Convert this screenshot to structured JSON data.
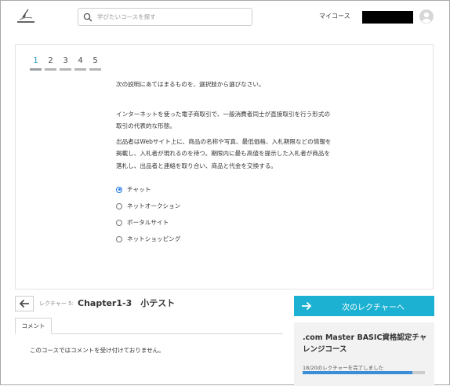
{
  "header": {
    "search_placeholder": "学びたいコースを探す",
    "my_course_label": "マイコース"
  },
  "quiz": {
    "tabs": [
      {
        "label": "1",
        "active": true
      },
      {
        "label": "2",
        "active": false
      },
      {
        "label": "3",
        "active": false
      },
      {
        "label": "4",
        "active": false
      },
      {
        "label": "5",
        "active": false
      }
    ],
    "instruction": "次の説明にあてはまるものを、選択肢から選びなさい。",
    "paragraph1": "インターネットを使った電子商取引で、一般消費者同士が直接取引を行う形式の取引の代表的な形態。",
    "paragraph2": "出品者はWebサイト上に、商品の名称や写真、最低価格、入札期限などの情報を掲載し、入札者が現れるのを待つ。期限内に最も高値を提示した入札者が商品を落札し、出品者と連絡を取り合い、商品と代金を交換する。",
    "options": [
      {
        "label": "チャット",
        "selected": true
      },
      {
        "label": "ネットオークション",
        "selected": false
      },
      {
        "label": "ポータルサイト",
        "selected": false
      },
      {
        "label": "ネットショッピング",
        "selected": false
      }
    ]
  },
  "lecture": {
    "label": "レクチャー 5:",
    "title": "Chapter1-3　小テスト",
    "next_button_label": "次のレクチャーへ"
  },
  "comments": {
    "tab_label": "コメント",
    "message": "このコースではコメントを受け付けておりません。"
  },
  "course": {
    "title": ".com Master BASIC資格認定チャレンジコース",
    "progress_text": "18/20のレクチャーを完了しました",
    "progress_completed": 18,
    "progress_total": 20
  },
  "colors": {
    "accent": "#1cb1d2",
    "progress": "#3a8ed6",
    "active_tab": "#1b8fc2"
  }
}
